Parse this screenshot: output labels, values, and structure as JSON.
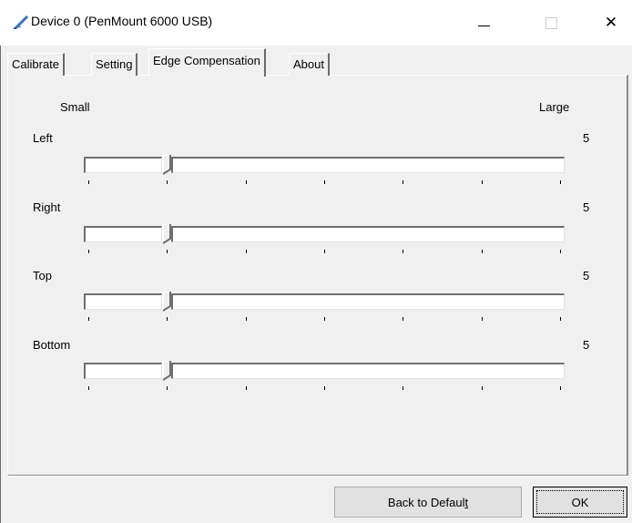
{
  "window": {
    "title": "Device 0 (PenMount 6000 USB)",
    "icon": "pen-icon",
    "controls": {
      "minimize": "—",
      "close": "✕"
    }
  },
  "tabs": [
    {
      "label": "Calibrate",
      "active": false
    },
    {
      "label": "Setting",
      "active": false
    },
    {
      "label": "Edge Compensation",
      "active": true
    },
    {
      "label": "About",
      "active": false
    }
  ],
  "scale": {
    "small": "Small",
    "large": "Large"
  },
  "sliders": [
    {
      "label": "Left",
      "value": "5"
    },
    {
      "label": "Right",
      "value": "5"
    },
    {
      "label": "Top",
      "value": "5"
    },
    {
      "label": "Bottom",
      "value": "5"
    }
  ],
  "buttons": {
    "default_prefix": "Back to Defaul",
    "default_underlined": "t",
    "ok": "OK"
  }
}
